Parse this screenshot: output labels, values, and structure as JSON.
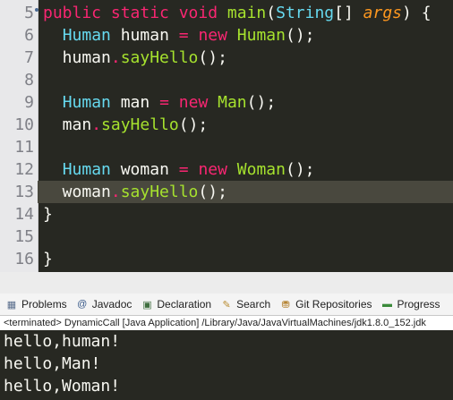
{
  "editor": {
    "line_numbers": [
      "5",
      "6",
      "7",
      "8",
      "9",
      "10",
      "11",
      "12",
      "13",
      "14",
      "15",
      "16"
    ],
    "lines": [
      [
        [
          "kw",
          "public "
        ],
        [
          "kw",
          "static "
        ],
        [
          "kw",
          "void "
        ],
        [
          "fn",
          "main"
        ],
        [
          "pl",
          "("
        ],
        [
          "ty",
          "String"
        ],
        [
          "pl",
          "[] "
        ],
        [
          "var",
          "args"
        ],
        [
          "pl",
          ") {"
        ]
      ],
      [
        [
          "pl",
          "  "
        ],
        [
          "ty",
          "Human "
        ],
        [
          "pl",
          "human "
        ],
        [
          "kw",
          "= "
        ],
        [
          "kw",
          "new "
        ],
        [
          "fn",
          "Human"
        ],
        [
          "pl",
          "();"
        ]
      ],
      [
        [
          "pl",
          "  human"
        ],
        [
          "kw",
          "."
        ],
        [
          "fn",
          "sayHello"
        ],
        [
          "pl",
          "();"
        ]
      ],
      [],
      [
        [
          "pl",
          "  "
        ],
        [
          "ty",
          "Human "
        ],
        [
          "pl",
          "man "
        ],
        [
          "kw",
          "= "
        ],
        [
          "kw",
          "new "
        ],
        [
          "fn",
          "Man"
        ],
        [
          "pl",
          "();"
        ]
      ],
      [
        [
          "pl",
          "  man"
        ],
        [
          "kw",
          "."
        ],
        [
          "fn",
          "sayHello"
        ],
        [
          "pl",
          "();"
        ]
      ],
      [],
      [
        [
          "pl",
          "  "
        ],
        [
          "ty",
          "Human "
        ],
        [
          "pl",
          "woman "
        ],
        [
          "kw",
          "= "
        ],
        [
          "kw",
          "new "
        ],
        [
          "fn",
          "Woman"
        ],
        [
          "pl",
          "();"
        ]
      ],
      [
        [
          "pl",
          "  woman"
        ],
        [
          "kw",
          "."
        ],
        [
          "fn",
          "sayHello"
        ],
        [
          "pl",
          "();"
        ]
      ],
      [
        [
          "pl",
          "}"
        ]
      ],
      [],
      [
        [
          "pl",
          "}"
        ]
      ]
    ],
    "highlighted_line": "13"
  },
  "tabs": [
    {
      "label": "Problems",
      "icon": "problems-icon"
    },
    {
      "label": "Javadoc",
      "icon": "javadoc-icon"
    },
    {
      "label": "Declaration",
      "icon": "declaration-icon"
    },
    {
      "label": "Search",
      "icon": "search-icon"
    },
    {
      "label": "Git Repositories",
      "icon": "git-repositories-icon"
    },
    {
      "label": "Progress",
      "icon": "progress-icon"
    }
  ],
  "console": {
    "status": "<terminated> DynamicCall [Java Application] /Library/Java/JavaVirtualMachines/jdk1.8.0_152.jdk",
    "output": [
      "hello,human!",
      "hello,Man!",
      "hello,Woman!"
    ]
  },
  "colors": {
    "editor_bg": "#272822",
    "keyword": "#f92672",
    "type": "#66d9ef",
    "function": "#a6e22e",
    "parameter": "#fd971f",
    "text": "#f8f8f2",
    "current_line": "#49483e"
  }
}
